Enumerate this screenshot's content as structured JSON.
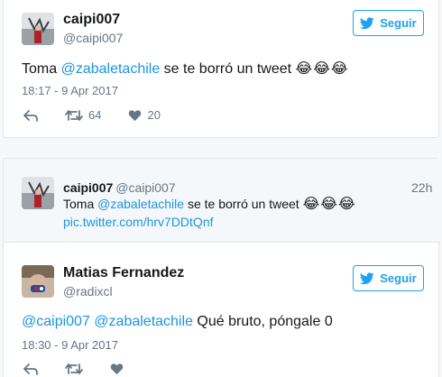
{
  "tweet": {
    "author_name": "caipi007",
    "author_handle": "@caipi007",
    "follow_label": "Seguir",
    "text_before": "Toma ",
    "mention": "@zabaletachile",
    "text_after": " se te borró un tweet ",
    "emojis": "😂😂😂",
    "timestamp": "18:17 - 9 Apr 2017",
    "retweets": "64",
    "likes": "20"
  },
  "reply": {
    "parent": {
      "author_name": "caipi007",
      "author_handle": "@caipi007",
      "time_ago": "22h",
      "text_before": "Toma ",
      "mention": "@zabaletachile",
      "text_after": " se te borró un tweet ",
      "emojis": "😂😂😂",
      "link": "pic.twitter.com/hrv7DDtQnf"
    },
    "author_name": "Matias Fernandez",
    "author_handle": "@radixcl",
    "follow_label": "Seguir",
    "mention1": "@caipi007",
    "mention2": "@zabaletachile",
    "text_after": " Qué bruto, póngale 0",
    "timestamp": "18:30 - 9 Apr 2017"
  },
  "colors": {
    "accent": "#1da1f2",
    "link": "#1b95e0",
    "muted": "#657786"
  }
}
